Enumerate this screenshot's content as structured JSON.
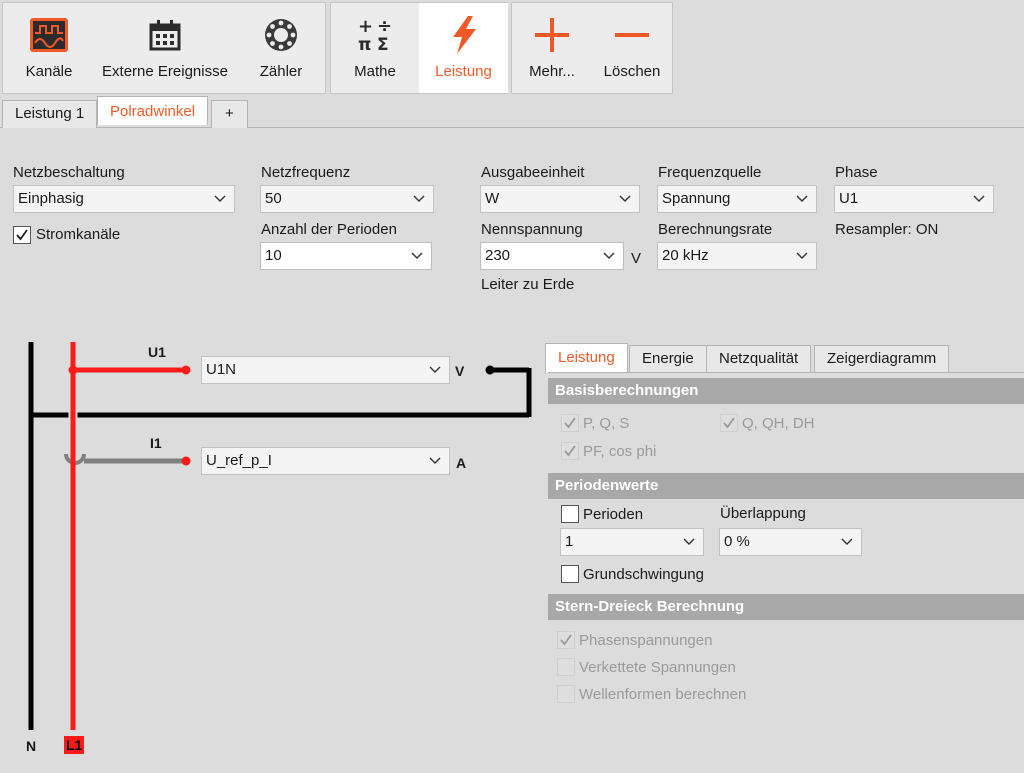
{
  "toolbar": {
    "group1": [
      {
        "label": "Kanäle",
        "icon": "channels-icon"
      },
      {
        "label": "Externe Ereignisse",
        "icon": "calendar-icon"
      },
      {
        "label": "Zähler",
        "icon": "counter-icon"
      }
    ],
    "group2": [
      {
        "label": "Mathe",
        "icon": "math-icon"
      },
      {
        "label": "Leistung",
        "icon": "lightning-icon",
        "active": true
      }
    ],
    "group3": [
      {
        "label": "Mehr...",
        "icon": "plus-icon"
      },
      {
        "label": "Löschen",
        "icon": "minus-icon"
      }
    ]
  },
  "tabs": [
    "Leistung 1",
    "Polradwinkel",
    "+"
  ],
  "active_tab": "Polradwinkel",
  "form": {
    "netzbeschaltung": {
      "label": "Netzbeschaltung",
      "value": "Einphasig"
    },
    "stromkanaele": {
      "label": "Stromkanäle",
      "checked": true
    },
    "netzfrequenz": {
      "label": "Netzfrequenz",
      "value": "50"
    },
    "anzahl_perioden": {
      "label": "Anzahl der Perioden",
      "value": "10"
    },
    "ausgabeeinheit": {
      "label": "Ausgabeeinheit",
      "value": "W"
    },
    "nennspannung": {
      "label": "Nennspannung",
      "value": "230",
      "unit": "V",
      "note": "Leiter zu Erde"
    },
    "frequenzquelle": {
      "label": "Frequenzquelle",
      "value": "Spannung"
    },
    "berechnungsrate": {
      "label": "Berechnungsrate",
      "value": "20 kHz"
    },
    "phase": {
      "label": "Phase",
      "value": "U1"
    },
    "resampler": "Resampler: ON"
  },
  "diagram": {
    "voltage_label": "U1",
    "voltage_channel": "U1N",
    "voltage_unit": "V",
    "current_label": "I1",
    "current_channel": "U_ref_p_I",
    "current_unit": "A",
    "neutral_label": "N",
    "line_label": "L1",
    "colors": {
      "line": "#ff1a1a",
      "neutral": "#000000",
      "current": "#808080"
    }
  },
  "panel": {
    "tabs": [
      "Leistung",
      "Energie",
      "Netzqualität",
      "Zeigerdiagramm"
    ],
    "active_tab": "Leistung",
    "basis": {
      "header": "Basisberechnungen",
      "items": [
        {
          "label": "P, Q, S",
          "checked": true,
          "enabled": false
        },
        {
          "label": "Q, QH, DH",
          "checked": true,
          "enabled": false
        },
        {
          "label": "PF, cos phi",
          "checked": true,
          "enabled": false
        }
      ]
    },
    "perioden": {
      "header": "Periodenwerte",
      "perioden_label": "Perioden",
      "perioden_checked": false,
      "perioden_value": "1",
      "ueberlappung_label": "Überlappung",
      "ueberlappung_value": "0 %",
      "grund_label": "Grundschwingung",
      "grund_checked": false
    },
    "stern": {
      "header": "Stern-Dreieck Berechnung",
      "items": [
        {
          "label": "Phasenspannungen",
          "checked": true,
          "enabled": false
        },
        {
          "label": "Verkettete Spannungen",
          "checked": false,
          "enabled": false
        },
        {
          "label": "Wellenformen berechnen",
          "checked": false,
          "enabled": false
        }
      ]
    }
  },
  "accent_color": "#f05a28"
}
